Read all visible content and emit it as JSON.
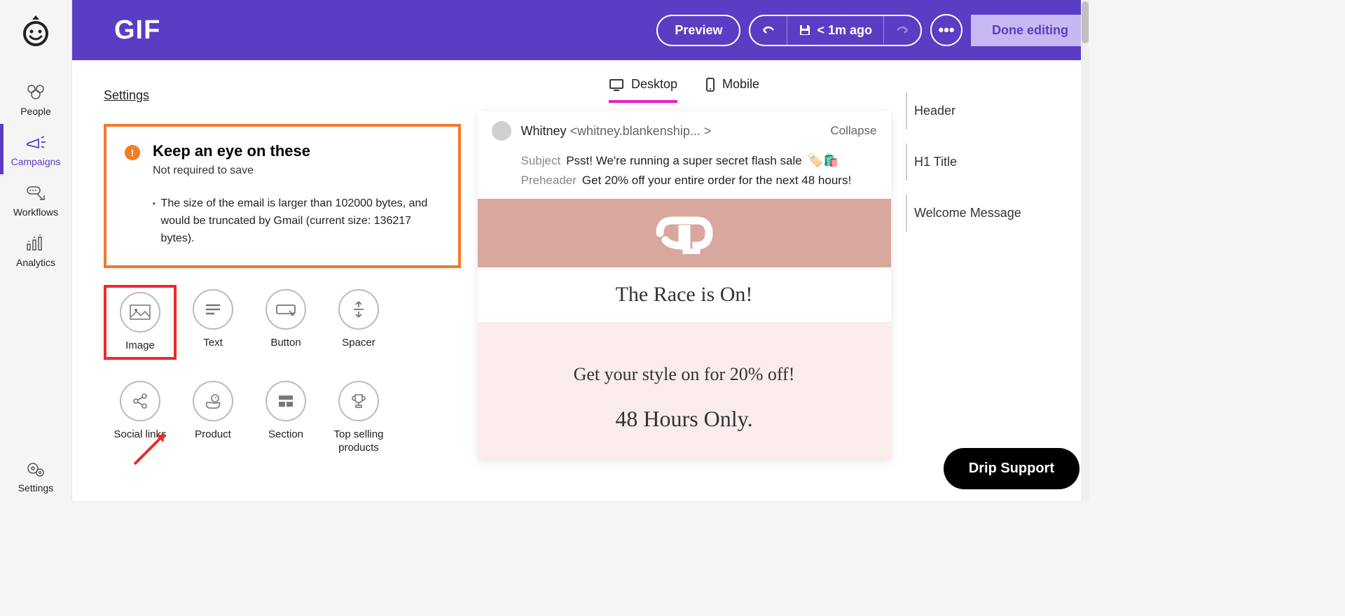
{
  "nav": {
    "items": [
      {
        "label": "People"
      },
      {
        "label": "Campaigns"
      },
      {
        "label": "Workflows"
      },
      {
        "label": "Analytics"
      },
      {
        "label": "Settings"
      }
    ]
  },
  "topbar": {
    "title": "GIF",
    "preview_label": "Preview",
    "save_status": "< 1m ago",
    "done_label": "Done editing"
  },
  "builder": {
    "settings_label": "Settings",
    "warning": {
      "title": "Keep an eye on these",
      "subtitle": "Not required to save",
      "message": "The size of the email is larger than 102000 bytes, and would be truncated by Gmail (current size: 136217 bytes)."
    },
    "blocks": [
      {
        "label": "Image"
      },
      {
        "label": "Text"
      },
      {
        "label": "Button"
      },
      {
        "label": "Spacer"
      },
      {
        "label": "Social links"
      },
      {
        "label": "Product"
      },
      {
        "label": "Section"
      },
      {
        "label": "Top selling products"
      }
    ]
  },
  "preview": {
    "tabs": {
      "desktop": "Desktop",
      "mobile": "Mobile"
    },
    "from_name": "Whitney",
    "from_email": "<whitney.blankenship... >",
    "collapse_label": "Collapse",
    "subject_label": "Subject",
    "subject_text": "Psst! We're running a super secret flash sale",
    "preheader_label": "Preheader",
    "preheader_text": "Get 20% off your entire order for the next 48 hours!",
    "body": {
      "h1": "The Race is On!",
      "welcome_line1": "Get your style on for 20% off!",
      "welcome_line2": "48 Hours Only."
    }
  },
  "outline": {
    "items": [
      {
        "label": "Header"
      },
      {
        "label": "H1 Title"
      },
      {
        "label": "Welcome Message"
      }
    ]
  },
  "support": {
    "label": "Drip Support"
  }
}
